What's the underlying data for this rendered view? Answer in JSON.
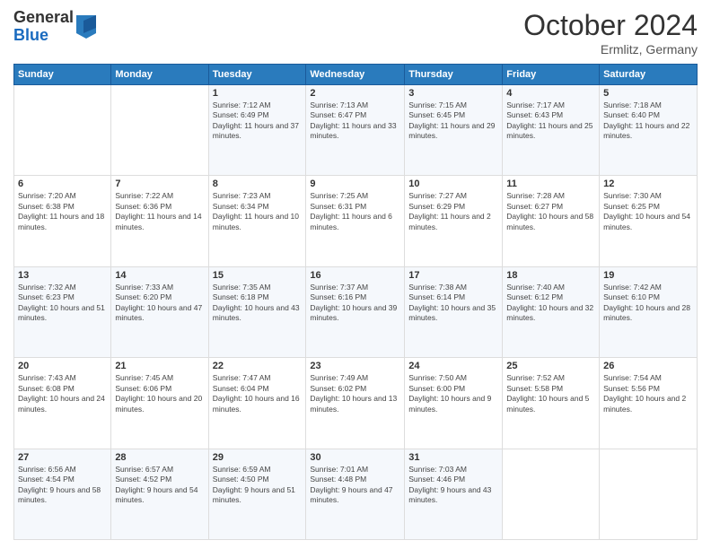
{
  "logo": {
    "general": "General",
    "blue": "Blue"
  },
  "title": "October 2024",
  "location": "Ermlitz, Germany",
  "days_header": [
    "Sunday",
    "Monday",
    "Tuesday",
    "Wednesday",
    "Thursday",
    "Friday",
    "Saturday"
  ],
  "weeks": [
    [
      null,
      null,
      {
        "day": 1,
        "sunrise": "7:12 AM",
        "sunset": "6:49 PM",
        "daylight": "11 hours and 37 minutes."
      },
      {
        "day": 2,
        "sunrise": "7:13 AM",
        "sunset": "6:47 PM",
        "daylight": "11 hours and 33 minutes."
      },
      {
        "day": 3,
        "sunrise": "7:15 AM",
        "sunset": "6:45 PM",
        "daylight": "11 hours and 29 minutes."
      },
      {
        "day": 4,
        "sunrise": "7:17 AM",
        "sunset": "6:43 PM",
        "daylight": "11 hours and 25 minutes."
      },
      {
        "day": 5,
        "sunrise": "7:18 AM",
        "sunset": "6:40 PM",
        "daylight": "11 hours and 22 minutes."
      }
    ],
    [
      {
        "day": 6,
        "sunrise": "7:20 AM",
        "sunset": "6:38 PM",
        "daylight": "11 hours and 18 minutes."
      },
      {
        "day": 7,
        "sunrise": "7:22 AM",
        "sunset": "6:36 PM",
        "daylight": "11 hours and 14 minutes."
      },
      {
        "day": 8,
        "sunrise": "7:23 AM",
        "sunset": "6:34 PM",
        "daylight": "11 hours and 10 minutes."
      },
      {
        "day": 9,
        "sunrise": "7:25 AM",
        "sunset": "6:31 PM",
        "daylight": "11 hours and 6 minutes."
      },
      {
        "day": 10,
        "sunrise": "7:27 AM",
        "sunset": "6:29 PM",
        "daylight": "11 hours and 2 minutes."
      },
      {
        "day": 11,
        "sunrise": "7:28 AM",
        "sunset": "6:27 PM",
        "daylight": "10 hours and 58 minutes."
      },
      {
        "day": 12,
        "sunrise": "7:30 AM",
        "sunset": "6:25 PM",
        "daylight": "10 hours and 54 minutes."
      }
    ],
    [
      {
        "day": 13,
        "sunrise": "7:32 AM",
        "sunset": "6:23 PM",
        "daylight": "10 hours and 51 minutes."
      },
      {
        "day": 14,
        "sunrise": "7:33 AM",
        "sunset": "6:20 PM",
        "daylight": "10 hours and 47 minutes."
      },
      {
        "day": 15,
        "sunrise": "7:35 AM",
        "sunset": "6:18 PM",
        "daylight": "10 hours and 43 minutes."
      },
      {
        "day": 16,
        "sunrise": "7:37 AM",
        "sunset": "6:16 PM",
        "daylight": "10 hours and 39 minutes."
      },
      {
        "day": 17,
        "sunrise": "7:38 AM",
        "sunset": "6:14 PM",
        "daylight": "10 hours and 35 minutes."
      },
      {
        "day": 18,
        "sunrise": "7:40 AM",
        "sunset": "6:12 PM",
        "daylight": "10 hours and 32 minutes."
      },
      {
        "day": 19,
        "sunrise": "7:42 AM",
        "sunset": "6:10 PM",
        "daylight": "10 hours and 28 minutes."
      }
    ],
    [
      {
        "day": 20,
        "sunrise": "7:43 AM",
        "sunset": "6:08 PM",
        "daylight": "10 hours and 24 minutes."
      },
      {
        "day": 21,
        "sunrise": "7:45 AM",
        "sunset": "6:06 PM",
        "daylight": "10 hours and 20 minutes."
      },
      {
        "day": 22,
        "sunrise": "7:47 AM",
        "sunset": "6:04 PM",
        "daylight": "10 hours and 16 minutes."
      },
      {
        "day": 23,
        "sunrise": "7:49 AM",
        "sunset": "6:02 PM",
        "daylight": "10 hours and 13 minutes."
      },
      {
        "day": 24,
        "sunrise": "7:50 AM",
        "sunset": "6:00 PM",
        "daylight": "10 hours and 9 minutes."
      },
      {
        "day": 25,
        "sunrise": "7:52 AM",
        "sunset": "5:58 PM",
        "daylight": "10 hours and 5 minutes."
      },
      {
        "day": 26,
        "sunrise": "7:54 AM",
        "sunset": "5:56 PM",
        "daylight": "10 hours and 2 minutes."
      }
    ],
    [
      {
        "day": 27,
        "sunrise": "6:56 AM",
        "sunset": "4:54 PM",
        "daylight": "9 hours and 58 minutes."
      },
      {
        "day": 28,
        "sunrise": "6:57 AM",
        "sunset": "4:52 PM",
        "daylight": "9 hours and 54 minutes."
      },
      {
        "day": 29,
        "sunrise": "6:59 AM",
        "sunset": "4:50 PM",
        "daylight": "9 hours and 51 minutes."
      },
      {
        "day": 30,
        "sunrise": "7:01 AM",
        "sunset": "4:48 PM",
        "daylight": "9 hours and 47 minutes."
      },
      {
        "day": 31,
        "sunrise": "7:03 AM",
        "sunset": "4:46 PM",
        "daylight": "9 hours and 43 minutes."
      },
      null,
      null
    ]
  ]
}
